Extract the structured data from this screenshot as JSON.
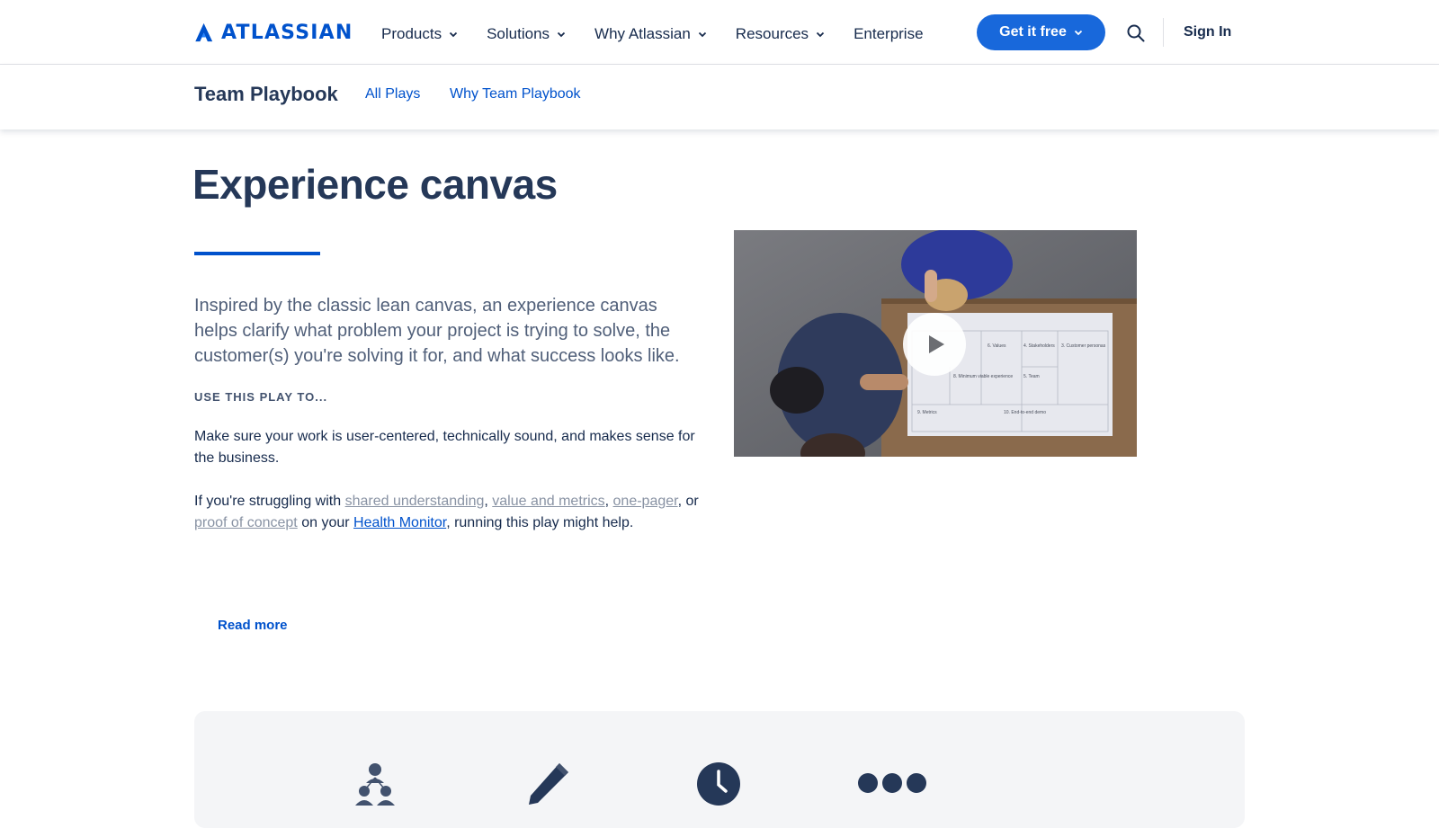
{
  "brand": {
    "name": "ATLASSIAN",
    "color": "#0052cc"
  },
  "topnav": {
    "items": [
      {
        "label": "Products",
        "has_menu": true
      },
      {
        "label": "Solutions",
        "has_menu": true
      },
      {
        "label": "Why Atlassian",
        "has_menu": true
      },
      {
        "label": "Resources",
        "has_menu": true
      },
      {
        "label": "Enterprise",
        "has_menu": false
      }
    ],
    "cta_label": "Get it free",
    "search_icon": "search-icon",
    "signin_label": "Sign In"
  },
  "subnav": {
    "title": "Team Playbook",
    "links": [
      "All Plays",
      "Why Team Playbook"
    ]
  },
  "main": {
    "title": "Experience canvas",
    "lead": "Inspired by the classic lean canvas, an experience canvas helps clarify what problem your project is trying to solve, the customer(s) you're solving it for, and what success looks like.",
    "eyebrow": "USE THIS PLAY TO...",
    "body1": "Make sure your work is user-centered, technically sound, and makes sense for the business.",
    "body2": {
      "prefix": "If you're struggling with ",
      "link1": "shared understanding",
      "sep1": ", ",
      "link2": "value and metrics",
      "sep2": ", ",
      "link3": "one-pager",
      "sep3": ", or ",
      "link4": "proof of concept",
      "mid": " on your ",
      "link5": "Health Monitor",
      "suffix": ", running this play might help."
    },
    "read_more": "Read more"
  },
  "video": {
    "play_icon": "play-icon",
    "canvas_labels": [
      "6. Values",
      "4. Stakeholders",
      "3. Customer personas",
      "8. Minimum viable experience",
      "5. Team",
      "9. Metrics",
      "10. End-to-end demo"
    ]
  },
  "panel": {
    "icons": [
      "people-icon",
      "pencil-icon",
      "clock-icon",
      "more-dots-icon"
    ]
  }
}
